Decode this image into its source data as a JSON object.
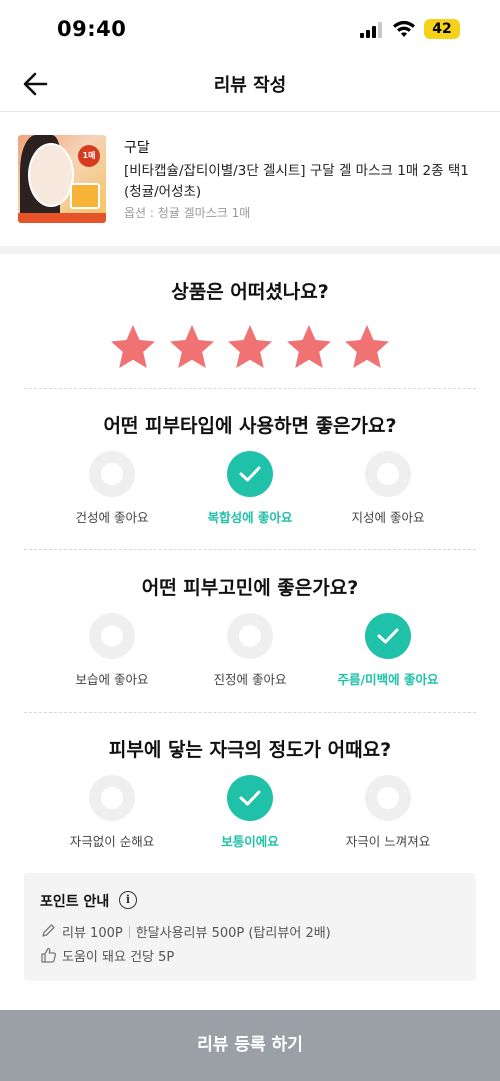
{
  "status_bar": {
    "time": "09:40",
    "battery": "42"
  },
  "header": {
    "title": "리뷰 작성"
  },
  "product": {
    "brand": "구달",
    "name": "[비타캡슐/잡티이별/3단 겔시트] 구달 겔 마스크 1매 2종 택1 (청귤/어성초)",
    "option": "옵션 : 청귤 겔마스크 1매",
    "thumb_badge": "1매"
  },
  "rating": {
    "question": "상품은 어떠셨나요?",
    "value": 5,
    "max": 5
  },
  "questions": [
    {
      "question": "어떤 피부타입에 사용하면 좋은가요?",
      "options": [
        {
          "label": "건성에 좋아요",
          "selected": false
        },
        {
          "label": "복합성에 좋아요",
          "selected": true
        },
        {
          "label": "지성에 좋아요",
          "selected": false
        }
      ]
    },
    {
      "question": "어떤 피부고민에 좋은가요?",
      "options": [
        {
          "label": "보습에 좋아요",
          "selected": false
        },
        {
          "label": "진정에 좋아요",
          "selected": false
        },
        {
          "label": "주름/미백에 좋아요",
          "selected": true
        }
      ]
    },
    {
      "question": "피부에 닿는 자극의 정도가 어때요?",
      "options": [
        {
          "label": "자극없이 순해요",
          "selected": false
        },
        {
          "label": "보통이에요",
          "selected": true
        },
        {
          "label": "자극이 느껴져요",
          "selected": false
        }
      ]
    }
  ],
  "points": {
    "title": "포인트 안내",
    "review": "리뷰 100P",
    "month_review": "한달사용리뷰 500P (탑리뷰어 2배)",
    "helpful": "도움이 돼요 건당 5P"
  },
  "submit_label": "리뷰 등록 하기",
  "colors": {
    "accent": "#1fc1a8",
    "star": "#f07272",
    "submit_bg": "#9aa0a6"
  },
  "icons": [
    "back-arrow-icon",
    "info-icon",
    "pencil-icon",
    "thumbs-up-icon",
    "check-icon",
    "star-icon"
  ]
}
